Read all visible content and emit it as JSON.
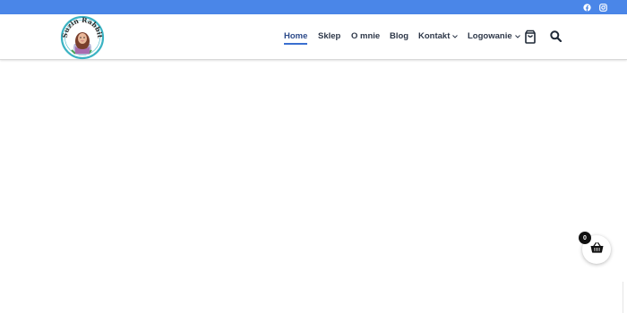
{
  "topbar": {
    "background": "#4a86e8",
    "social_icons": [
      "facebook-icon",
      "instagram-icon"
    ]
  },
  "header": {
    "logo_text": "Suzin Rabbit",
    "nav": {
      "home": "Home",
      "shop": "Sklep",
      "about": "O mnie",
      "blog": "Blog",
      "contact": "Kontakt",
      "login": "Logowanie"
    },
    "active_item": "Home",
    "accent": "#3a6fd0",
    "icons": [
      "cart-icon",
      "search-icon"
    ]
  },
  "floating_cart": {
    "count": "0",
    "icon": "basket-icon"
  }
}
